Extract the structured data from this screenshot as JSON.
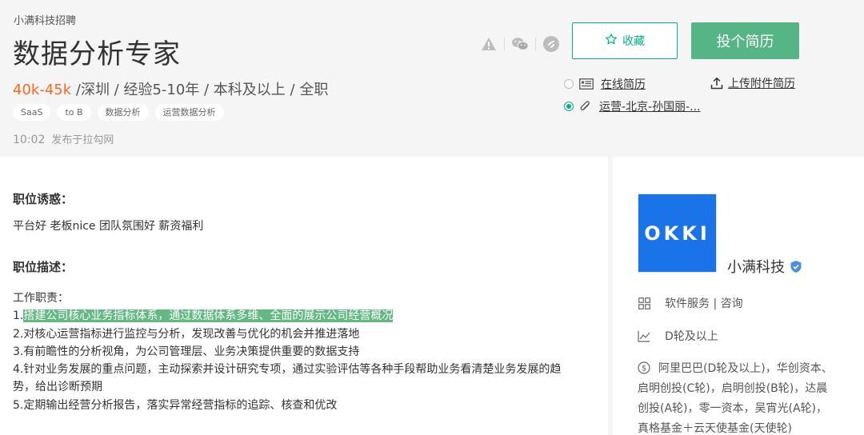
{
  "company": "小满科技招聘",
  "job_title": "数据分析专家",
  "salary": "40k-45k",
  "requirements": " /深圳 / 经验5-10年 / 本科及以上 / 全职",
  "tags": [
    "SaaS",
    "to B",
    "数据分析",
    "运营数据分析"
  ],
  "publish_time": "10:02",
  "publish_source": "发布于拉勾网",
  "favorite_label": "收藏",
  "apply_label": "投个简历",
  "online_resume_label": "在线简历",
  "attached_resume_label": "运营-北京-孙国丽-...",
  "upload_label": "上传附件简历",
  "sections": {
    "perks_title": "职位诱惑：",
    "perks_text": "平台好 老板nice 团队氛围好 薪资福利",
    "desc_title": "职位描述："
  },
  "description": {
    "intro": "工作职责：",
    "item1_prefix": "1.",
    "item1_highlight": "搭建公司核心业务指标体系，通过数据体系多维、全面的展示公司经营概况",
    "item2": "2.对核心运营指标进行监控与分析，发现改善与优化的机会并推进落地",
    "item3": "3.有前瞻性的分析视角，为公司管理层、业务决策提供重要的数据支持",
    "item4": "4.针对业务发展的重点问题，主动探索并设计研究专项，通过实验评估等各种手段帮助业务看清楚业务发展的趋势，给出诊断预期",
    "item5": "5.定期输出经营分析报告，落实异常经营指标的追踪、核查和优改"
  },
  "sidebar": {
    "logo_text": "OKKI",
    "company_name": "小满科技",
    "industry": "软件服务 | 咨询",
    "stage": "D轮及以上",
    "investors": "阿里巴巴(D轮及以上)，华创资本、启明创投(C轮)，启明创投(B轮)，达晨创投(A轮)，零一资本，吴宵光(A轮)，真格基金＋云天使基金(天使轮)"
  },
  "colors": {
    "accent": "#00b38a",
    "apply_button": "#55b584",
    "salary": "#fd661f",
    "highlight": "#62b984",
    "logo_bg": "#1a73e8"
  }
}
